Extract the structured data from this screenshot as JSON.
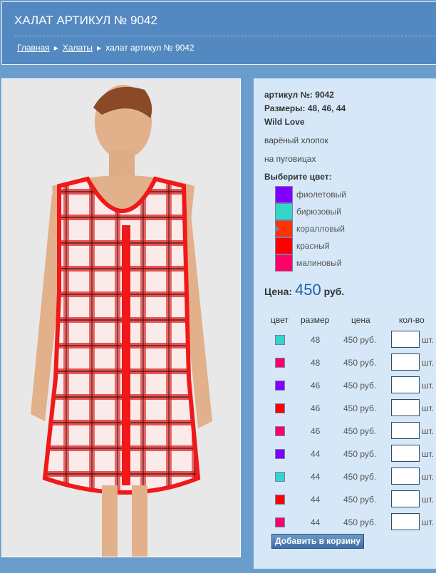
{
  "header": {
    "title": "ХАЛАТ АРТИКУЛ № 9042",
    "breadcrumbs": [
      "Главная",
      "Халаты",
      "халат артикул № 9042"
    ]
  },
  "product": {
    "article": "артикул №: 9042",
    "sizes": "Размеры: 48, 46, 44",
    "brand": "Wild Love",
    "material": "варёный хлопок",
    "fastening": "на пуговицах",
    "choose_color": "Выберите цвет:",
    "colors": [
      {
        "name": "фиолетовый",
        "hex": "#8000ff"
      },
      {
        "name": "бирюзовый",
        "hex": "#33d6c8"
      },
      {
        "name": "коралловый",
        "hex": "#ff3300"
      },
      {
        "name": "красный",
        "hex": "#ff0000"
      },
      {
        "name": "малиновый",
        "hex": "#ff0066"
      }
    ],
    "selected_color": "коралловый",
    "price_label": "Цена:",
    "price_value": "450",
    "price_currency": "руб."
  },
  "table": {
    "headers": [
      "цвет",
      "размер",
      "цена",
      "кол-во"
    ],
    "unit": "шт.",
    "rows": [
      {
        "color": "#33d6c8",
        "size": "48",
        "price": "450 руб.",
        "qty": ""
      },
      {
        "color": "#ff0066",
        "size": "48",
        "price": "450 руб.",
        "qty": ""
      },
      {
        "color": "#8000ff",
        "size": "46",
        "price": "450 руб.",
        "qty": ""
      },
      {
        "color": "#ff0000",
        "size": "46",
        "price": "450 руб.",
        "qty": ""
      },
      {
        "color": "#ff0066",
        "size": "46",
        "price": "450 руб.",
        "qty": ""
      },
      {
        "color": "#8000ff",
        "size": "44",
        "price": "450 руб.",
        "qty": ""
      },
      {
        "color": "#33d6c8",
        "size": "44",
        "price": "450 руб.",
        "qty": ""
      },
      {
        "color": "#ff0000",
        "size": "44",
        "price": "450 руб.",
        "qty": ""
      },
      {
        "color": "#ff0066",
        "size": "44",
        "price": "450 руб.",
        "qty": ""
      }
    ]
  },
  "add_to_cart": "Добавить в корзину"
}
